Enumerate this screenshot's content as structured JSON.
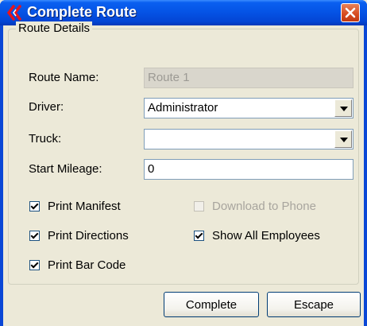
{
  "window": {
    "title": "Complete Route",
    "icon": "route-app-icon",
    "close_icon": "close-icon"
  },
  "group": {
    "legend": "Route Details"
  },
  "fields": {
    "route_name": {
      "label": "Route Name:",
      "value": "Route 1",
      "disabled": true
    },
    "driver": {
      "label": "Driver:",
      "value": "Administrator"
    },
    "truck": {
      "label": "Truck:",
      "value": ""
    },
    "start_mileage": {
      "label": "Start Mileage:",
      "value": "0"
    }
  },
  "checkboxes": {
    "print_manifest": {
      "label": "Print Manifest",
      "checked": true
    },
    "download_to_phone": {
      "label": "Download to Phone",
      "checked": false,
      "disabled": true
    },
    "print_directions": {
      "label": "Print Directions",
      "checked": true
    },
    "show_all_employees": {
      "label": "Show All Employees",
      "checked": true
    },
    "print_bar_code": {
      "label": "Print Bar Code",
      "checked": true
    }
  },
  "buttons": {
    "complete": "Complete",
    "escape": "Escape"
  },
  "colors": {
    "titlebar": "#0554e6",
    "close": "#d64a1e",
    "dialog_bg": "#ece9d8"
  }
}
